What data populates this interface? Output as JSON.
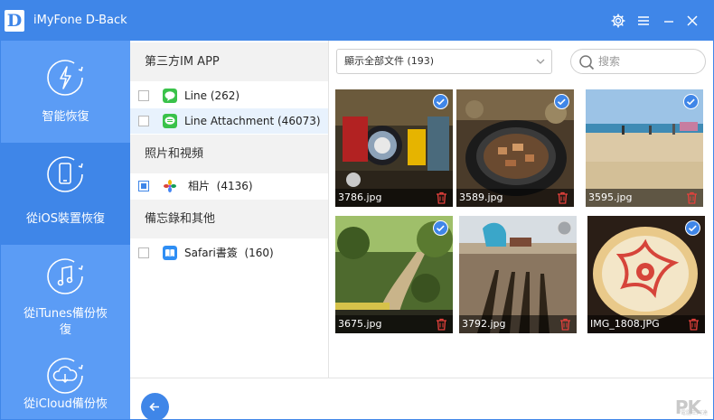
{
  "app": {
    "title": "iMyFone D-Back",
    "logo_letter": "D",
    "accent": "#3f86e8",
    "nav_color": "#5b9cf5"
  },
  "titlebar_icons": [
    "gear-icon",
    "menu-icon",
    "minimize-icon",
    "close-icon"
  ],
  "sidebar": {
    "items": [
      {
        "label": "智能恢復",
        "icon": "lightning-refresh-icon",
        "active": false
      },
      {
        "label": "從iOS裝置恢復",
        "icon": "phone-refresh-icon",
        "active": true
      },
      {
        "label": "從iTunes備份恢復",
        "icon": "music-note-refresh-icon",
        "active": false
      },
      {
        "label": "從iCloud備份恢",
        "icon": "cloud-download-refresh-icon",
        "active": false
      }
    ]
  },
  "categories": {
    "groups": [
      {
        "header": "第三方IM APP",
        "items": [
          {
            "name": "Line",
            "count": "(262)",
            "icon": "line-app-icon",
            "checked": false,
            "selected": false
          },
          {
            "name": "Line Attachment",
            "count": "(46073)",
            "icon": "line-attachment-icon",
            "checked": false,
            "selected": true
          }
        ]
      },
      {
        "header": "照片和視頻",
        "items": [
          {
            "name": "相片",
            "count": "(4136)",
            "icon": "photos-icon",
            "checked": true,
            "selected": false
          }
        ]
      },
      {
        "header": "備忘錄和其他",
        "items": [
          {
            "name": "Safari書簽",
            "count": "(160)",
            "icon": "safari-bookmarks-icon",
            "checked": false,
            "selected": false
          }
        ]
      }
    ]
  },
  "content": {
    "filter": {
      "selected": "顯示全部文件 (193)"
    },
    "search": {
      "placeholder": "搜索"
    },
    "photos": [
      {
        "name": "3786.jpg",
        "checked": true
      },
      {
        "name": "3589.jpg",
        "checked": true
      },
      {
        "name": "3595.jpg",
        "checked": true
      },
      {
        "name": "3675.jpg",
        "checked": true
      },
      {
        "name": "3792.jpg",
        "checked": false
      },
      {
        "name": "IMG_1808.JPG",
        "checked": true
      }
    ]
  },
  "footer": {
    "back_icon": "arrow-left-icon",
    "watermark": "PK",
    "watermark_sub": "電腦王阿達"
  }
}
